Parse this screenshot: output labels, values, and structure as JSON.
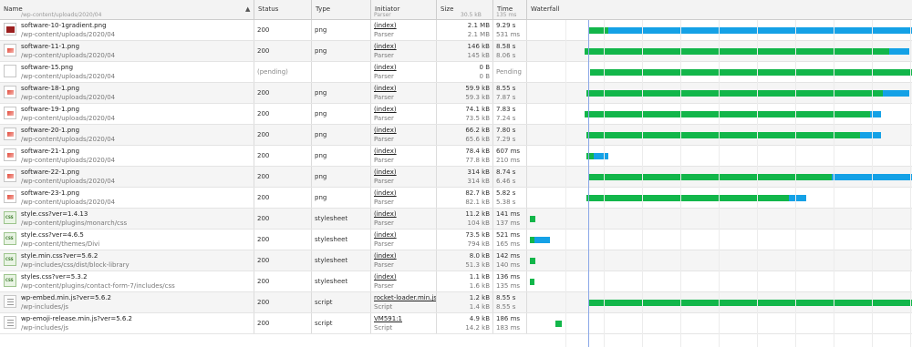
{
  "columns": {
    "name": "Name",
    "status": "Status",
    "type": "Type",
    "initiator": "Initiator",
    "size": "Size",
    "time": "Time",
    "waterfall": "Waterfall"
  },
  "sort_icon": "sort-triangle-up",
  "top_partial": {
    "path": "/wp-content/uploads/2020/04",
    "initiator": "Parser",
    "size": "30.5 kB",
    "time": "135 ms"
  },
  "colors": {
    "waiting": "#12b64a",
    "download": "#14a1e6",
    "marker": "#8aa7e8"
  },
  "requests": [
    {
      "name": "software-10-1gradient.png",
      "path": "/wp-content/uploads/2020/04",
      "status": "200",
      "type": "png",
      "initiator": "(index)",
      "initiator_type": "Parser",
      "size": "2.1 MB",
      "resource_size": "2.1 MB",
      "time": "9.29 s",
      "latency": "531 ms",
      "thumb": "red-image-icon"
    },
    {
      "name": "software-11-1.png",
      "path": "/wp-content/uploads/2020/04",
      "status": "200",
      "type": "png",
      "initiator": "(index)",
      "initiator_type": "Parser",
      "size": "146 kB",
      "resource_size": "145 kB",
      "time": "8.58 s",
      "latency": "8.06 s",
      "thumb": "image-icon"
    },
    {
      "name": "software-15.png",
      "path": "/wp-content/uploads/2020/04",
      "status": "(pending)",
      "type": "",
      "initiator": "(index)",
      "initiator_type": "Parser",
      "size": "0 B",
      "resource_size": "0 B",
      "time": "Pending",
      "latency": "",
      "thumb": "blank-image-icon"
    },
    {
      "name": "software-18-1.png",
      "path": "/wp-content/uploads/2020/04",
      "status": "200",
      "type": "png",
      "initiator": "(index)",
      "initiator_type": "Parser",
      "size": "59.9 kB",
      "resource_size": "59.3 kB",
      "time": "8.55 s",
      "latency": "7.87 s",
      "thumb": "image-icon"
    },
    {
      "name": "software-19-1.png",
      "path": "/wp-content/uploads/2020/04",
      "status": "200",
      "type": "png",
      "initiator": "(index)",
      "initiator_type": "Parser",
      "size": "74.1 kB",
      "resource_size": "73.5 kB",
      "time": "7.83 s",
      "latency": "7.24 s",
      "thumb": "image-icon"
    },
    {
      "name": "software-20-1.png",
      "path": "/wp-content/uploads/2020/04",
      "status": "200",
      "type": "png",
      "initiator": "(index)",
      "initiator_type": "Parser",
      "size": "66.2 kB",
      "resource_size": "65.6 kB",
      "time": "7.80 s",
      "latency": "7.29 s",
      "thumb": "image-icon"
    },
    {
      "name": "software-21-1.png",
      "path": "/wp-content/uploads/2020/04",
      "status": "200",
      "type": "png",
      "initiator": "(index)",
      "initiator_type": "Parser",
      "size": "78.4 kB",
      "resource_size": "77.8 kB",
      "time": "607 ms",
      "latency": "210 ms",
      "thumb": "image-icon"
    },
    {
      "name": "software-22-1.png",
      "path": "/wp-content/uploads/2020/04",
      "status": "200",
      "type": "png",
      "initiator": "(index)",
      "initiator_type": "Parser",
      "size": "314 kB",
      "resource_size": "314 kB",
      "time": "8.74 s",
      "latency": "6.46 s",
      "thumb": "image-icon"
    },
    {
      "name": "software-23-1.png",
      "path": "/wp-content/uploads/2020/04",
      "status": "200",
      "type": "png",
      "initiator": "(index)",
      "initiator_type": "Parser",
      "size": "82.7 kB",
      "resource_size": "82.1 kB",
      "time": "5.82 s",
      "latency": "5.38 s",
      "thumb": "image-icon"
    },
    {
      "name": "style.css?ver=1.4.13",
      "path": "/wp-content/plugins/monarch/css",
      "status": "200",
      "type": "stylesheet",
      "initiator": "(index)",
      "initiator_type": "Parser",
      "size": "11.2 kB",
      "resource_size": "104 kB",
      "time": "141 ms",
      "latency": "137 ms",
      "thumb": "css-file-icon"
    },
    {
      "name": "style.css?ver=4.6.5",
      "path": "/wp-content/themes/Divi",
      "status": "200",
      "type": "stylesheet",
      "initiator": "(index)",
      "initiator_type": "Parser",
      "size": "73.5 kB",
      "resource_size": "794 kB",
      "time": "521 ms",
      "latency": "165 ms",
      "thumb": "css-file-icon"
    },
    {
      "name": "style.min.css?ver=5.6.2",
      "path": "/wp-includes/css/dist/block-library",
      "status": "200",
      "type": "stylesheet",
      "initiator": "(index)",
      "initiator_type": "Parser",
      "size": "8.0 kB",
      "resource_size": "51.3 kB",
      "time": "142 ms",
      "latency": "140 ms",
      "thumb": "css-file-icon"
    },
    {
      "name": "styles.css?ver=5.3.2",
      "path": "/wp-content/plugins/contact-form-7/includes/css",
      "status": "200",
      "type": "stylesheet",
      "initiator": "(index)",
      "initiator_type": "Parser",
      "size": "1.1 kB",
      "resource_size": "1.6 kB",
      "time": "136 ms",
      "latency": "135 ms",
      "thumb": "css-file-icon"
    },
    {
      "name": "wp-embed.min.js?ver=5.6.2",
      "path": "/wp-includes/js",
      "status": "200",
      "type": "script",
      "initiator": "rocket-loader.min.js:1",
      "initiator_type": "Script",
      "size": "1.2 kB",
      "resource_size": "1.4 kB",
      "time": "8.55 s",
      "latency": "8.55 s",
      "thumb": "js-file-icon"
    },
    {
      "name": "wp-emoji-release.min.js?ver=5.6.2",
      "path": "/wp-includes/js",
      "status": "200",
      "type": "script",
      "initiator": "VM591:1",
      "initiator_type": "Script",
      "size": "4.9 kB",
      "resource_size": "14.2 kB",
      "time": "186 ms",
      "latency": "183 ms",
      "thumb": "js-file-icon"
    }
  ]
}
